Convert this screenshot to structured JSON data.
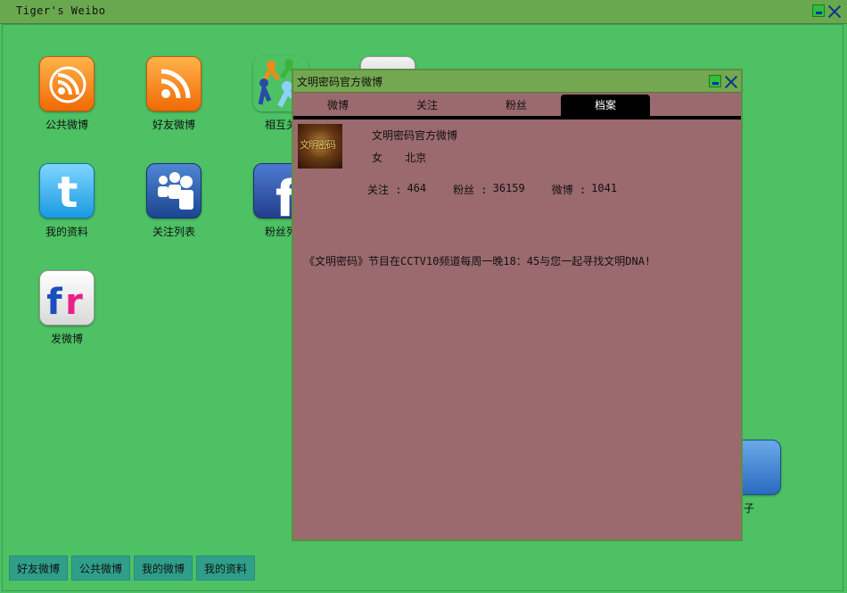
{
  "app": {
    "title": "Tiger's Weibo"
  },
  "desktop": {
    "icons": [
      {
        "label": "公共微博",
        "icon": "rss-icon"
      },
      {
        "label": "好友微博",
        "icon": "rss-icon"
      },
      {
        "label": "相互关",
        "icon": "people-icon"
      },
      {
        "label": "我的资料",
        "icon": "twitter-icon"
      },
      {
        "label": "关注列表",
        "icon": "myspace-icon"
      },
      {
        "label": "粉丝列",
        "icon": "facebook-icon"
      },
      {
        "label": "发微博",
        "icon": "flickr-icon"
      },
      {
        "label": "子",
        "icon": "blue-tile-icon"
      }
    ]
  },
  "taskbar": {
    "buttons": [
      "好友微博",
      "公共微博",
      "我的微博",
      "我的资料"
    ]
  },
  "dialog": {
    "title": "文明密码官方微博",
    "tabs": [
      "微博",
      "关注",
      "粉丝",
      "档案"
    ],
    "active_tab": "档案",
    "profile": {
      "name": "文明密码官方微博",
      "gender": "女",
      "location": "北京",
      "avatar_text": "文明密码",
      "follow_label": "关注 :",
      "follow_value": "464",
      "fans_label": "粉丝 :",
      "fans_value": "36159",
      "weibo_label": "微博 :",
      "weibo_value": "1041",
      "bio": "《文明密码》节目在CCTV10频道每周一晚18：45与您一起寻找文明DNA!"
    }
  },
  "colors": {
    "desktop_bg": "#4dc164",
    "dialog_bg": "#9b6a6e",
    "titlebar": "#6aa84f",
    "taskbar_btn": "#2f9f8a"
  }
}
